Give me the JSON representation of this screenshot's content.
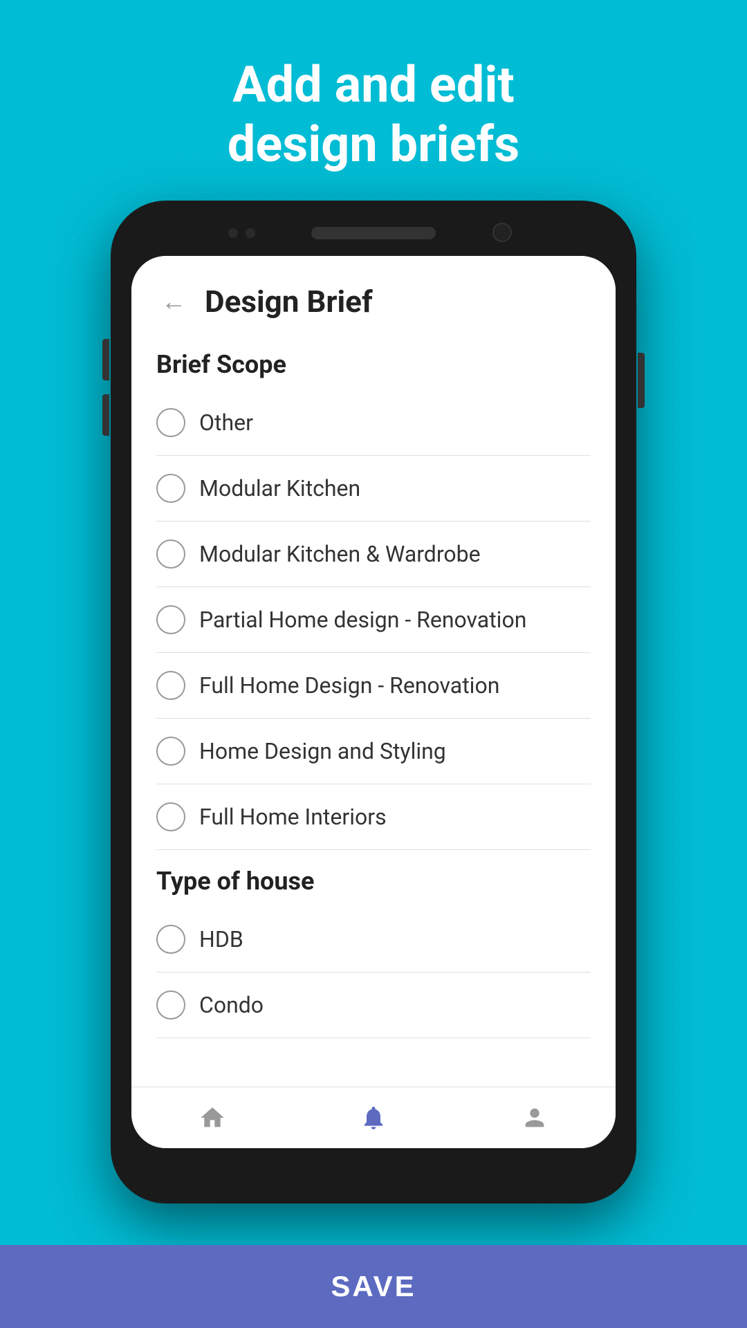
{
  "headline": {
    "line1": "Add and edit",
    "line2": "design briefs"
  },
  "app": {
    "title": "Design Brief",
    "back_label": "←"
  },
  "brief_scope": {
    "section_title": "Brief Scope",
    "options": [
      {
        "label": "Other",
        "checked": false
      },
      {
        "label": "Modular Kitchen",
        "checked": false
      },
      {
        "label": "Modular Kitchen & Wardrobe",
        "checked": false
      },
      {
        "label": "Partial Home design - Renovation",
        "checked": false
      },
      {
        "label": "Full Home Design - Renovation",
        "checked": false
      },
      {
        "label": "Home Design and Styling",
        "checked": false
      },
      {
        "label": "Full Home Interiors",
        "checked": false
      }
    ]
  },
  "type_of_house": {
    "section_title": "Type of house",
    "options": [
      {
        "label": "HDB",
        "checked": false
      },
      {
        "label": "Condo",
        "checked": false
      }
    ]
  },
  "save_button": {
    "label": "SAVE"
  },
  "bottom_nav": {
    "items": [
      {
        "icon": "home",
        "label": "Home",
        "active": false
      },
      {
        "icon": "notification",
        "label": "Notifications",
        "active": true
      },
      {
        "icon": "profile",
        "label": "Profile",
        "active": false
      }
    ]
  }
}
